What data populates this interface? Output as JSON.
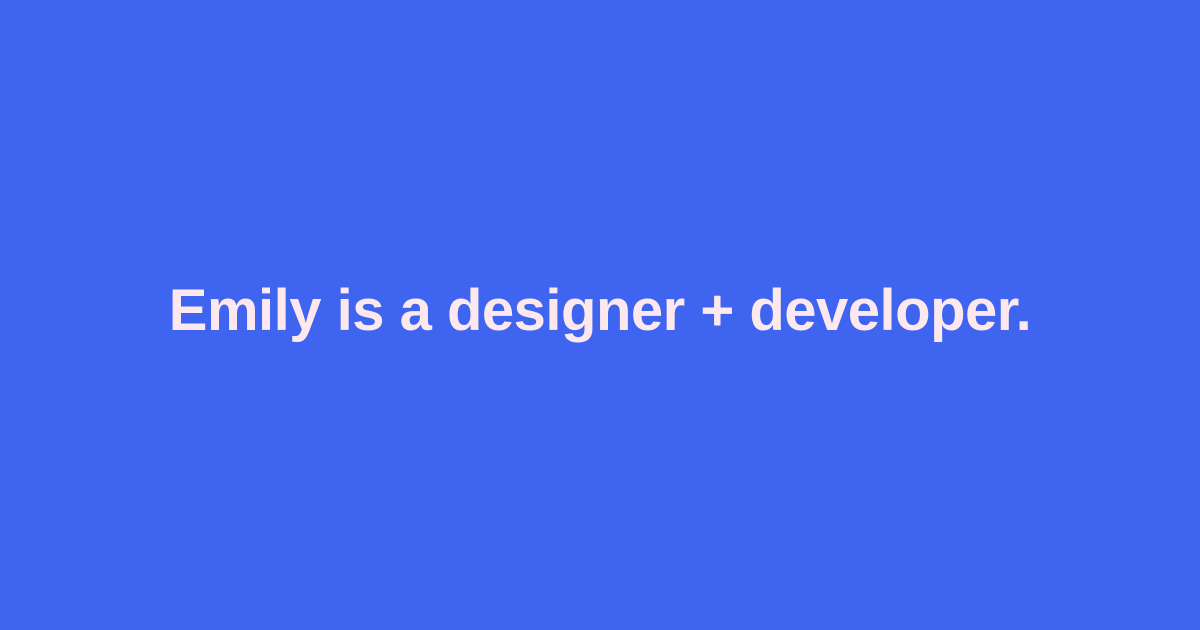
{
  "headline": "Emily is a designer + developer.",
  "colors": {
    "background": "#3e64f0",
    "text": "#fde8ee"
  }
}
